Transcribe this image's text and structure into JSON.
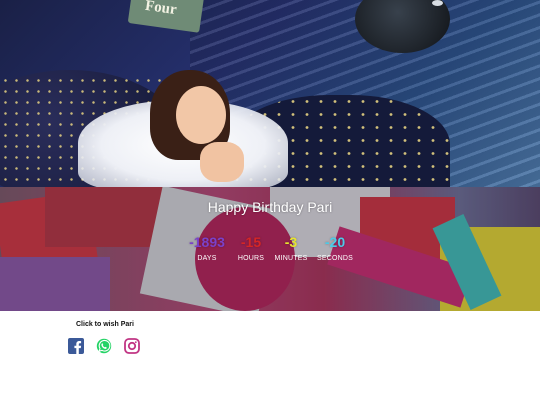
{
  "hero": {
    "decor_text": "Four"
  },
  "countdown": {
    "title": "Happy Birthday Pari",
    "units": [
      {
        "value": "-1893",
        "label": "DAYS",
        "color": "#7b41c9"
      },
      {
        "value": "-15",
        "label": "HOURS",
        "color": "#d52626"
      },
      {
        "value": "-3",
        "label": "MINUTES",
        "color": "#e7e52c"
      },
      {
        "value": "-20",
        "label": "SECONDS",
        "color": "#4ccbe9"
      }
    ]
  },
  "wish": {
    "label": "Click to wish Pari"
  },
  "social": [
    {
      "name": "facebook-icon",
      "color": "#3b5998"
    },
    {
      "name": "whatsapp-icon",
      "color": "#25d366"
    },
    {
      "name": "instagram-icon",
      "color": "#c13584"
    }
  ]
}
